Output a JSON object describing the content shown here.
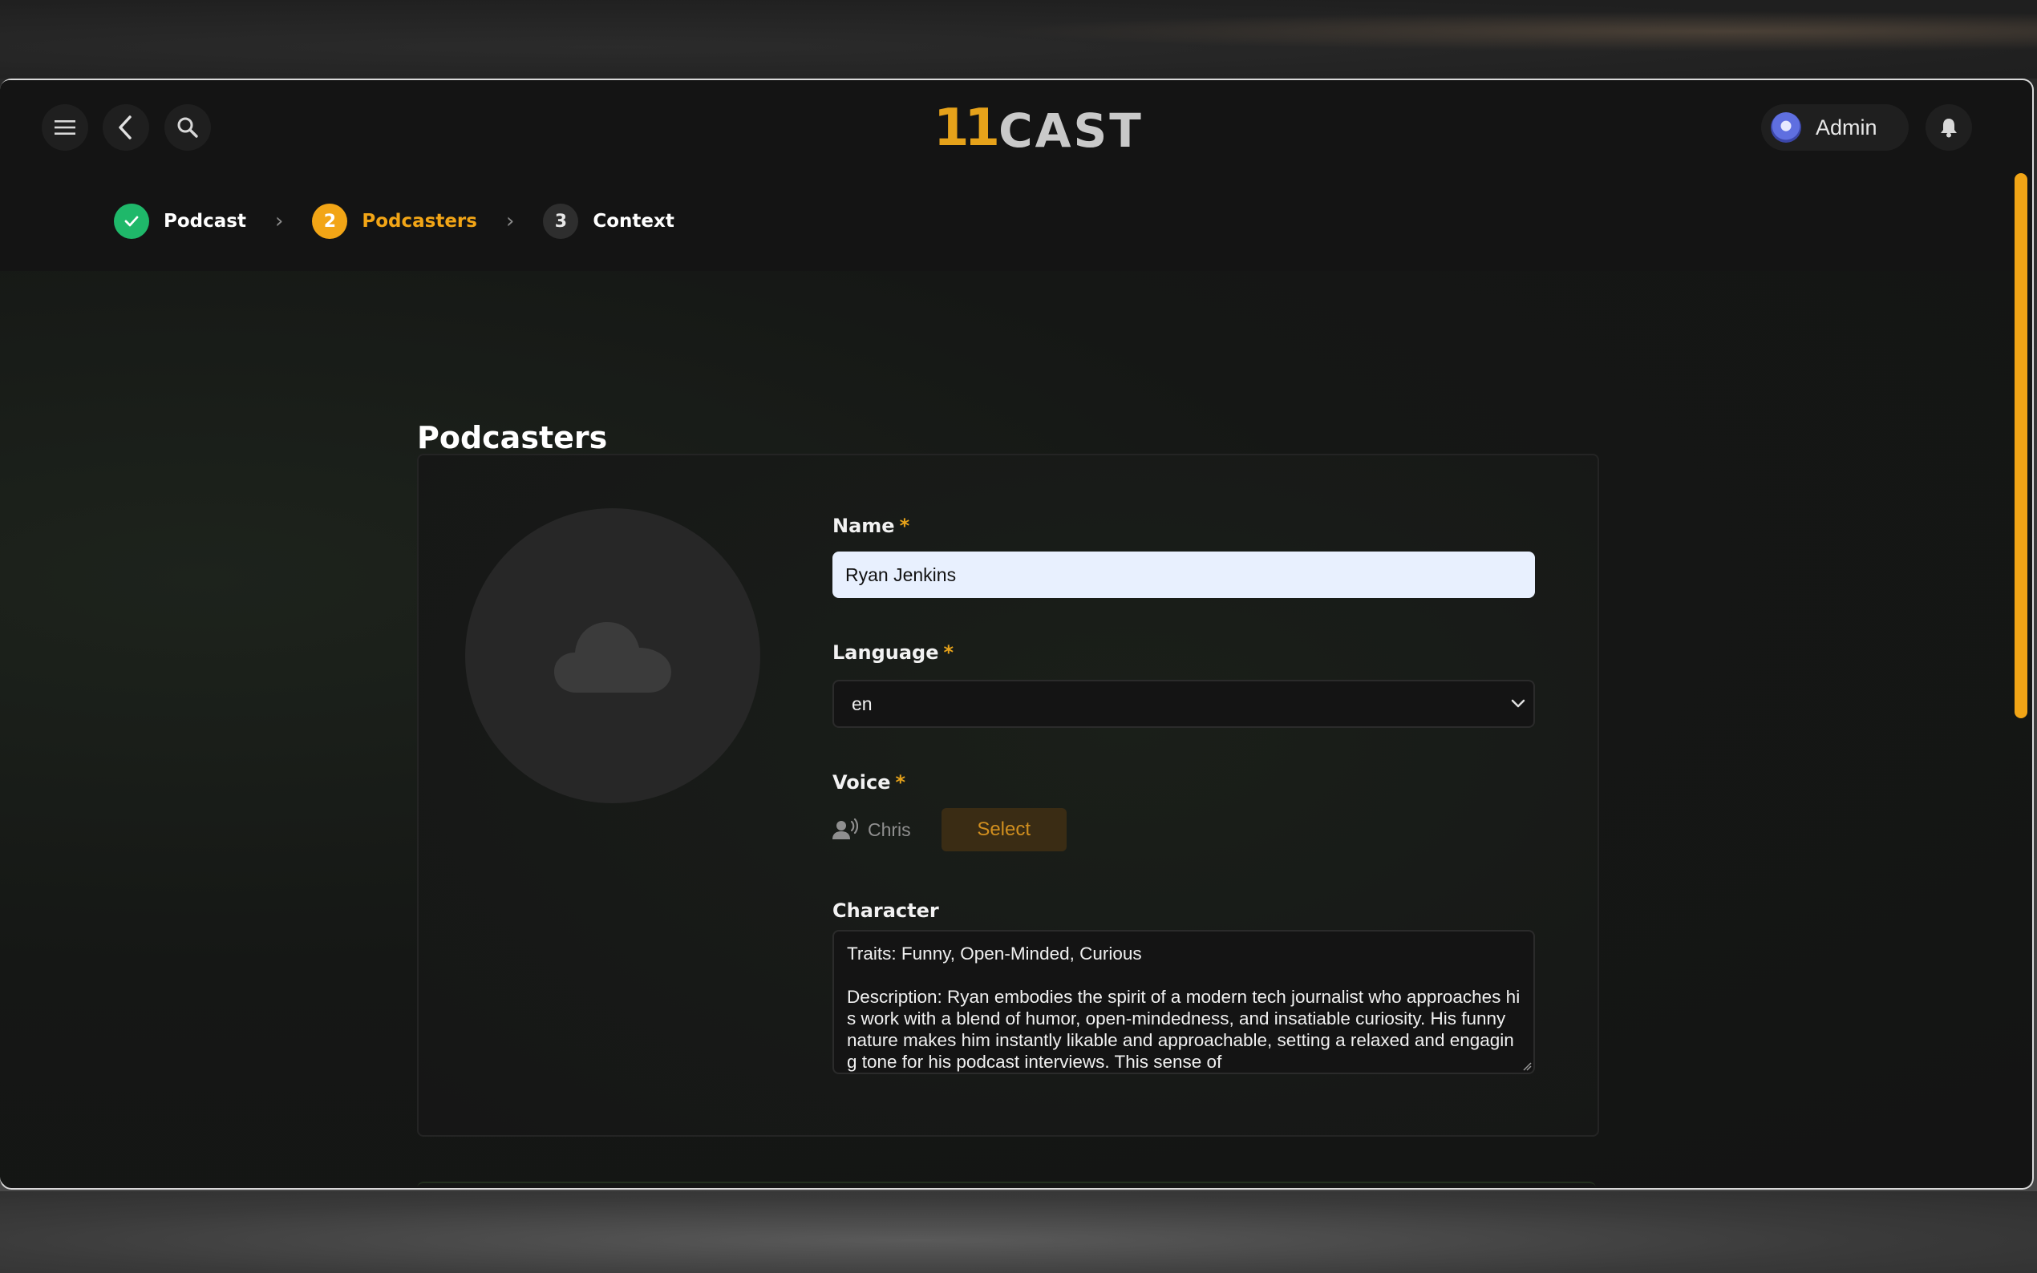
{
  "header": {
    "logo_number": "11",
    "logo_word": "CAST",
    "user_name": "Admin"
  },
  "steps": [
    {
      "number": "✓",
      "label": "Podcast",
      "state": "done"
    },
    {
      "number": "2",
      "label": "Podcasters",
      "state": "active"
    },
    {
      "number": "3",
      "label": "Context",
      "state": "pending"
    }
  ],
  "page": {
    "title": "Podcasters"
  },
  "form": {
    "name_label": "Name",
    "name_value": "Ryan Jenkins",
    "language_label": "Language",
    "language_value": "en",
    "voice_label": "Voice",
    "voice_name": "Chris",
    "voice_select_label": "Select",
    "character_label": "Character",
    "character_value": "Traits: Funny, Open-Minded, Curious\n\nDescription: Ryan embodies the spirit of a modern tech journalist who approaches his work with a blend of humor, open-mindedness, and insatiable curiosity. His funny nature makes him instantly likable and approachable, setting a relaxed and engaging tone for his podcast interviews. This sense of",
    "required_mark": "*"
  },
  "colors": {
    "accent": "#e6a21a",
    "success": "#1fb86a",
    "background": "#161616"
  }
}
